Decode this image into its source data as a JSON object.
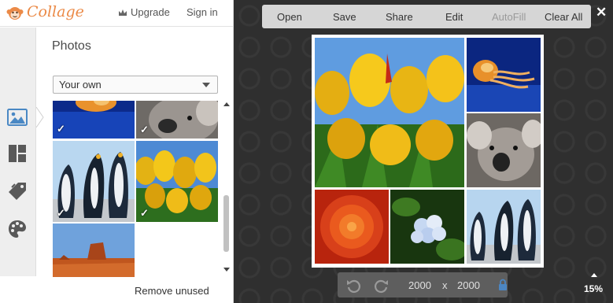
{
  "app": {
    "name": "Collage"
  },
  "header": {
    "upgrade_label": "Upgrade",
    "signin_label": "Sign in"
  },
  "toolrail": {
    "items": [
      {
        "name": "photos",
        "icon": "image-icon",
        "active": true
      },
      {
        "name": "layouts",
        "icon": "layout-icon"
      },
      {
        "name": "stickers",
        "icon": "tag-icon"
      },
      {
        "name": "backgrounds",
        "icon": "palette-icon"
      }
    ]
  },
  "photos_panel": {
    "title": "Photos",
    "source_selected": "Your own",
    "remove_unused_label": "Remove unused",
    "thumbnails": [
      {
        "subject": "jellyfish",
        "checked": true
      },
      {
        "subject": "koala",
        "checked": true
      },
      {
        "subject": "penguins",
        "checked": true
      },
      {
        "subject": "tulips",
        "checked": true
      },
      {
        "subject": "desert",
        "checked": false
      }
    ],
    "check_glyph": "✓"
  },
  "toolbar": {
    "open_label": "Open",
    "save_label": "Save",
    "share_label": "Share",
    "edit_label": "Edit",
    "autofill_label": "AutoFill",
    "clear_all_label": "Clear All",
    "close_glyph": "✕"
  },
  "collage": {
    "cells": [
      "tulips",
      "jellyfish",
      "koala",
      "chrysanthemum",
      "hydrangea",
      "penguins"
    ]
  },
  "canvas_size": {
    "width": "2000",
    "separator": "x",
    "height": "2000",
    "locked": true
  },
  "zoom": {
    "level": "15%"
  },
  "colors": {
    "accent": "#eb8a47",
    "workspace_bg": "#2f2f2f",
    "toolbar_bg": "#d6d6d6"
  }
}
